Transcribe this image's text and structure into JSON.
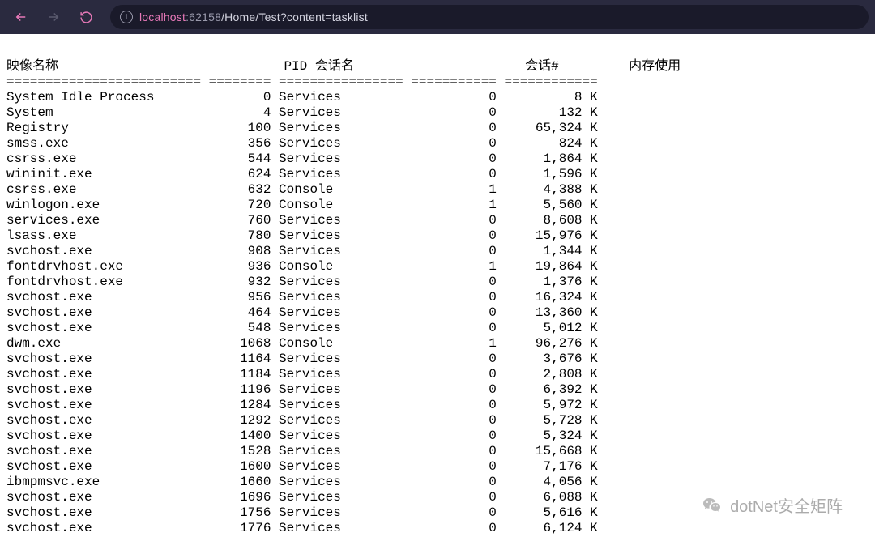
{
  "browser": {
    "url_host": "localhost",
    "url_port": ":62158",
    "url_path": "/Home/Test?content=tasklist",
    "info_glyph": "i"
  },
  "headers": {
    "image_name": "映像名称",
    "pid": "PID",
    "session_name": "会话名",
    "session_num": "会话#",
    "mem_usage": "内存使用"
  },
  "separator": {
    "image_name": "=========================",
    "pid": "========",
    "session_name": "================",
    "session_num": "===========",
    "mem_usage": "============"
  },
  "processes": [
    {
      "name": "System Idle Process",
      "pid": 0,
      "session": "Services",
      "snum": 0,
      "mem": "8 K"
    },
    {
      "name": "System",
      "pid": 4,
      "session": "Services",
      "snum": 0,
      "mem": "132 K"
    },
    {
      "name": "Registry",
      "pid": 100,
      "session": "Services",
      "snum": 0,
      "mem": "65,324 K"
    },
    {
      "name": "smss.exe",
      "pid": 356,
      "session": "Services",
      "snum": 0,
      "mem": "824 K"
    },
    {
      "name": "csrss.exe",
      "pid": 544,
      "session": "Services",
      "snum": 0,
      "mem": "1,864 K"
    },
    {
      "name": "wininit.exe",
      "pid": 624,
      "session": "Services",
      "snum": 0,
      "mem": "1,596 K"
    },
    {
      "name": "csrss.exe",
      "pid": 632,
      "session": "Console",
      "snum": 1,
      "mem": "4,388 K"
    },
    {
      "name": "winlogon.exe",
      "pid": 720,
      "session": "Console",
      "snum": 1,
      "mem": "5,560 K"
    },
    {
      "name": "services.exe",
      "pid": 760,
      "session": "Services",
      "snum": 0,
      "mem": "8,608 K"
    },
    {
      "name": "lsass.exe",
      "pid": 780,
      "session": "Services",
      "snum": 0,
      "mem": "15,976 K"
    },
    {
      "name": "svchost.exe",
      "pid": 908,
      "session": "Services",
      "snum": 0,
      "mem": "1,344 K"
    },
    {
      "name": "fontdrvhost.exe",
      "pid": 936,
      "session": "Console",
      "snum": 1,
      "mem": "19,864 K"
    },
    {
      "name": "fontdrvhost.exe",
      "pid": 932,
      "session": "Services",
      "snum": 0,
      "mem": "1,376 K"
    },
    {
      "name": "svchost.exe",
      "pid": 956,
      "session": "Services",
      "snum": 0,
      "mem": "16,324 K"
    },
    {
      "name": "svchost.exe",
      "pid": 464,
      "session": "Services",
      "snum": 0,
      "mem": "13,360 K"
    },
    {
      "name": "svchost.exe",
      "pid": 548,
      "session": "Services",
      "snum": 0,
      "mem": "5,012 K"
    },
    {
      "name": "dwm.exe",
      "pid": 1068,
      "session": "Console",
      "snum": 1,
      "mem": "96,276 K"
    },
    {
      "name": "svchost.exe",
      "pid": 1164,
      "session": "Services",
      "snum": 0,
      "mem": "3,676 K"
    },
    {
      "name": "svchost.exe",
      "pid": 1184,
      "session": "Services",
      "snum": 0,
      "mem": "2,808 K"
    },
    {
      "name": "svchost.exe",
      "pid": 1196,
      "session": "Services",
      "snum": 0,
      "mem": "6,392 K"
    },
    {
      "name": "svchost.exe",
      "pid": 1284,
      "session": "Services",
      "snum": 0,
      "mem": "5,972 K"
    },
    {
      "name": "svchost.exe",
      "pid": 1292,
      "session": "Services",
      "snum": 0,
      "mem": "5,728 K"
    },
    {
      "name": "svchost.exe",
      "pid": 1400,
      "session": "Services",
      "snum": 0,
      "mem": "5,324 K"
    },
    {
      "name": "svchost.exe",
      "pid": 1528,
      "session": "Services",
      "snum": 0,
      "mem": "15,668 K"
    },
    {
      "name": "svchost.exe",
      "pid": 1600,
      "session": "Services",
      "snum": 0,
      "mem": "7,176 K"
    },
    {
      "name": "ibmpmsvc.exe",
      "pid": 1660,
      "session": "Services",
      "snum": 0,
      "mem": "4,056 K"
    },
    {
      "name": "svchost.exe",
      "pid": 1696,
      "session": "Services",
      "snum": 0,
      "mem": "6,088 K"
    },
    {
      "name": "svchost.exe",
      "pid": 1756,
      "session": "Services",
      "snum": 0,
      "mem": "5,616 K"
    },
    {
      "name": "svchost.exe",
      "pid": 1776,
      "session": "Services",
      "snum": 0,
      "mem": "6,124 K"
    }
  ],
  "watermark": {
    "text": "dotNet安全矩阵"
  }
}
